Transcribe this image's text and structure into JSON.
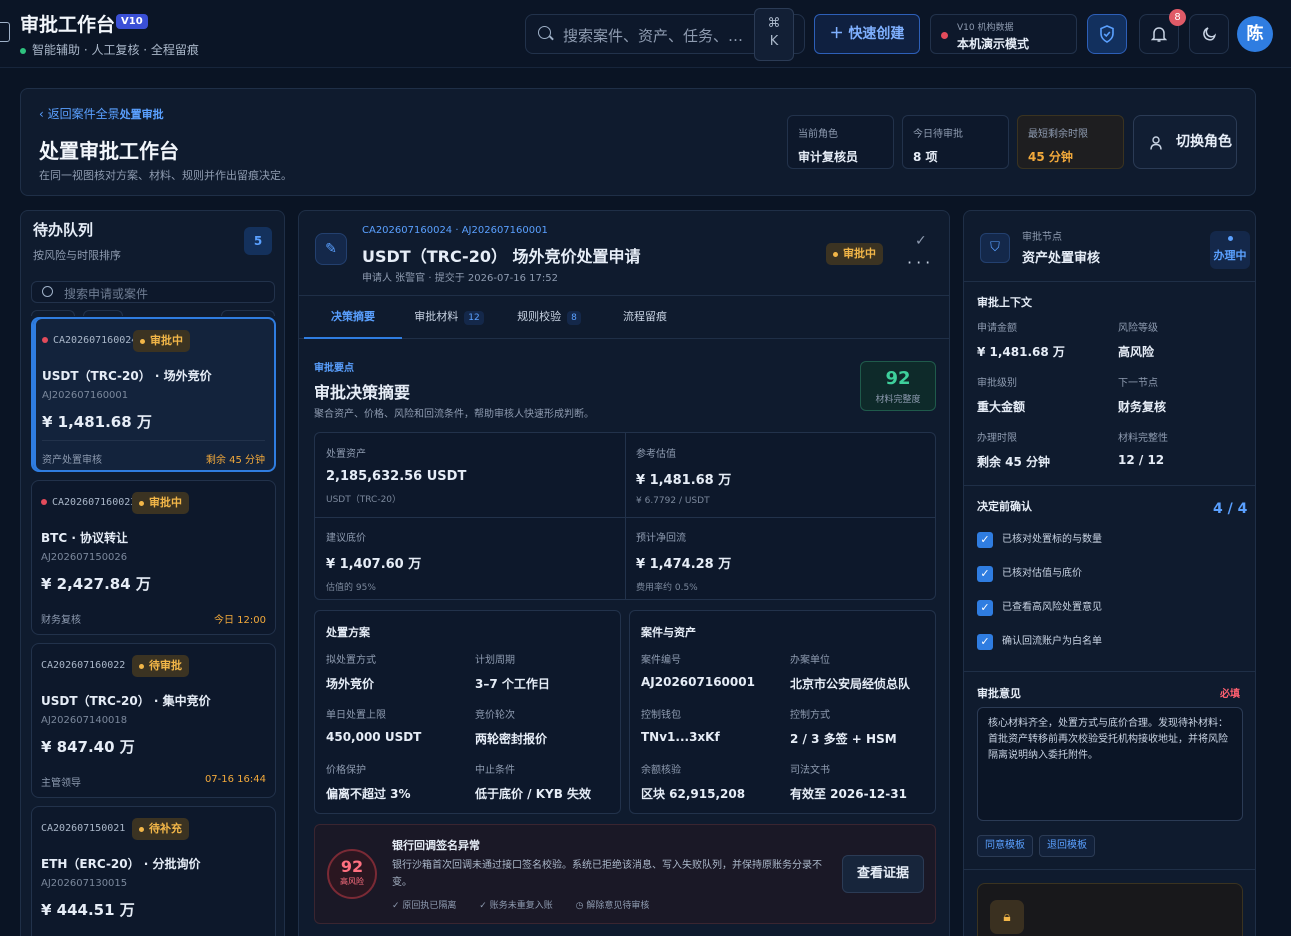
{
  "topbar": {
    "title": "审批工作台",
    "version": "V10",
    "subtitle": "智能辅助 · 人工复核 · 全程留痕",
    "search_placeholder": "搜索案件、资产、任务、…",
    "kbd_cmd": "⌘",
    "kbd_key": "K",
    "quick_create": "快速创建",
    "env_label": "V10 机构数据",
    "env_mode": "本机演示模式",
    "notifications": "8",
    "avatar": "陈"
  },
  "header": {
    "back_link": "返回案件全景",
    "crumb": "处置审批",
    "title": "处置审批工作台",
    "subtitle": "在同一视图核对方案、材料、规则并作出留痕决定。",
    "stats": [
      {
        "label": "当前角色",
        "value": "审计复核员"
      },
      {
        "label": "今日待审批",
        "value": "8 项"
      },
      {
        "label": "最短剩余时限",
        "value": "45 分钟"
      }
    ],
    "switch_role": "切换角色"
  },
  "queue": {
    "title": "待办队列",
    "subtitle": "按风险与时限排序",
    "count": "5",
    "search_placeholder": "搜索申请或案件",
    "items": [
      {
        "code": "CA202607160024",
        "status": "审批中",
        "name": "USDT（TRC-20） · 场外竞价",
        "aj": "AJ202607160001",
        "amount": "¥ 1,481.68 万",
        "node": "资产处置审核",
        "due": "剩余 45 分钟"
      },
      {
        "code": "CA202607160023",
        "status": "审批中",
        "name": "BTC · 协议转让",
        "aj": "AJ202607150026",
        "amount": "¥ 2,427.84 万",
        "node": "财务复核",
        "due": "今日 12:00"
      },
      {
        "code": "CA202607160022",
        "status": "待审批",
        "name": "USDT（TRC-20） · 集中竞价",
        "aj": "AJ202607140018",
        "amount": "¥ 847.40 万",
        "node": "主管领导",
        "due": "07-16 16:44"
      },
      {
        "code": "CA202607150021",
        "status": "待补充",
        "name": "ETH（ERC-20） · 分批询价",
        "aj": "AJ202607130015",
        "amount": "¥ 444.51 万"
      }
    ]
  },
  "detail": {
    "codes": "CA202607160024 · AJ202607160001",
    "title": "USDT（TRC-20） 场外竞价处置申请",
    "meta": "申请人 张警官 · 提交于 2026-07-16 17:52",
    "status": "审批中",
    "tabs": [
      {
        "label": "决策摘要",
        "count": ""
      },
      {
        "label": "审批材料",
        "count": "12"
      },
      {
        "label": "规则校验",
        "count": "8"
      },
      {
        "label": "流程留痕",
        "count": ""
      }
    ],
    "kicker": "审批要点",
    "section_title": "审批决策摘要",
    "section_sub": "聚合资产、价格、风险和回流条件，帮助审核人快速形成判断。",
    "score": "92",
    "score_label": "材料完整度",
    "metrics": [
      {
        "label": "处置资产",
        "value": "2,185,632.56 USDT",
        "sub": "USDT（TRC-20）"
      },
      {
        "label": "参考估值",
        "value": "¥ 1,481.68 万",
        "sub": "¥ 6.7792 / USDT"
      },
      {
        "label": "建议底价",
        "value": "¥ 1,407.60 万",
        "sub": "估值的 95%"
      },
      {
        "label": "预计净回流",
        "value": "¥ 1,474.28 万",
        "sub": "费用率约 0.5%"
      }
    ],
    "plan": {
      "title": "处置方案",
      "items": [
        {
          "label": "拟处置方式",
          "value": "场外竞价"
        },
        {
          "label": "计划周期",
          "value": "3–7 个工作日"
        },
        {
          "label": "单日处置上限",
          "value": "450,000 USDT"
        },
        {
          "label": "竞价轮次",
          "value": "两轮密封报价"
        },
        {
          "label": "价格保护",
          "value": "偏离不超过 3%"
        },
        {
          "label": "中止条件",
          "value": "低于底价 / KYB 失效"
        }
      ]
    },
    "case": {
      "title": "案件与资产",
      "items": [
        {
          "label": "案件编号",
          "value": "AJ202607160001"
        },
        {
          "label": "办案单位",
          "value": "北京市公安局经侦总队"
        },
        {
          "label": "控制钱包",
          "value": "TNv1...3xKf"
        },
        {
          "label": "控制方式",
          "value": "2 / 3 多签 + HSM"
        },
        {
          "label": "余额核验",
          "value": "区块 62,915,208"
        },
        {
          "label": "司法文书",
          "value": "有效至 2026-12-31"
        }
      ]
    },
    "alert": {
      "score": "92",
      "level": "高风险",
      "title": "银行回调签名异常",
      "desc": "银行沙箱首次回调未通过接口签名校验。系统已拒绝该消息、写入失败队列，并保持原账务分录不变。",
      "tags": [
        "原回执已隔离",
        "账务未重复入账",
        "解除意见待审核"
      ],
      "button": "查看证据"
    }
  },
  "approval": {
    "node_label": "审批节点",
    "node": "资产处置审核",
    "status": "办理中",
    "context_title": "审批上下文",
    "context": [
      {
        "label": "申请金额",
        "value": "¥ 1,481.68 万"
      },
      {
        "label": "风险等级",
        "value": "高风险"
      },
      {
        "label": "审批级别",
        "value": "重大金额"
      },
      {
        "label": "下一节点",
        "value": "财务复核"
      },
      {
        "label": "办理时限",
        "value": "剩余 45 分钟"
      },
      {
        "label": "材料完整性",
        "value": "12 / 12"
      }
    ],
    "confirm_title": "决定前确认",
    "confirm_count": "4 / 4",
    "checks": [
      "已核对处置标的与数量",
      "已核对估值与底价",
      "已查看高风险处置意见",
      "确认回流账户为白名单"
    ],
    "opinion_title": "审批意见",
    "required": "必填",
    "opinion_text": "核心材料齐全，处置方式与底价合理。发现待补材料：首批资产转移前再次校验受托机构接收地址，并将风险隔离说明纳入委托附件。",
    "templates": [
      "同意模板",
      "退回模板"
    ]
  },
  "colors": {
    "accent": "#2f7de1",
    "warning": "#f2b648",
    "danger": "#ff6070",
    "success": "#3ecf9b",
    "background": "#0a1424"
  }
}
